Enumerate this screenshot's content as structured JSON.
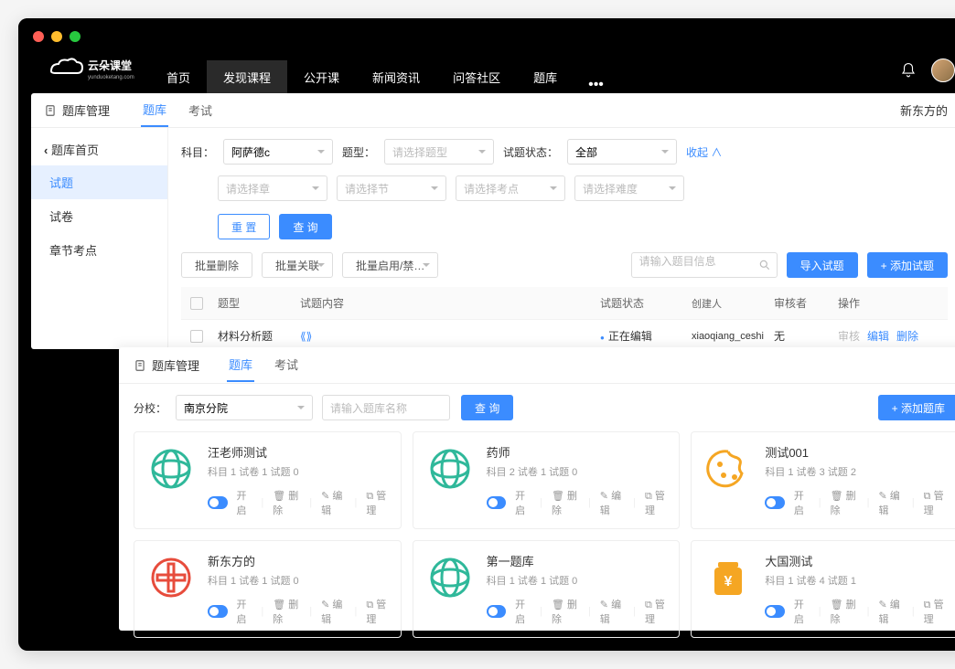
{
  "brand": {
    "name": "云朵课堂",
    "sub": "yunduoketang.com"
  },
  "nav": [
    {
      "label": "首页",
      "active": false
    },
    {
      "label": "发现课程",
      "active": true
    },
    {
      "label": "公开课",
      "active": false
    },
    {
      "label": "新闻资讯",
      "active": false
    },
    {
      "label": "问答社区",
      "active": false
    },
    {
      "label": "题库",
      "active": false
    }
  ],
  "panel1": {
    "breadcrumb_title": "题库管理",
    "right_tag": "新东方的",
    "back_label": "题库首页",
    "sidebar": [
      {
        "label": "试题",
        "active": true
      },
      {
        "label": "试卷",
        "active": false
      },
      {
        "label": "章节考点",
        "active": false
      }
    ],
    "tabs": [
      {
        "label": "题库",
        "active": true
      },
      {
        "label": "考试",
        "active": false
      }
    ],
    "filters": {
      "subject_label": "科目：",
      "subject_value": "阿萨德c",
      "type_label": "题型：",
      "type_ph": "请选择题型",
      "status_label": "试题状态：",
      "status_value": "全部",
      "collapse": "收起",
      "chapter_ph": "请选择章",
      "section_ph": "请选择节",
      "point_ph": "请选择考点",
      "difficulty_ph": "请选择难度"
    },
    "buttons": {
      "reset": "重 置",
      "query": "查 询",
      "batch_delete": "批量删除",
      "batch_relate": "批量关联",
      "batch_toggle": "批量启用/禁…",
      "search_ph": "请输入题目信息",
      "import": "导入试题",
      "add": "+ 添加试题"
    },
    "table": {
      "headers": {
        "type": "题型",
        "content": "试题内容",
        "status": "试题状态",
        "creator": "创建人",
        "reviewer": "审核者",
        "ops": "操作"
      },
      "rows": [
        {
          "type": "材料分析题",
          "content_icon": "audio",
          "status": "正在编辑",
          "creator": "xiaoqiang_ceshi",
          "reviewer": "无",
          "ops": {
            "review": "审核",
            "edit": "编辑",
            "delete": "删除"
          }
        }
      ]
    }
  },
  "panel2": {
    "title": "题库管理",
    "tabs": [
      {
        "label": "题库",
        "active": true
      },
      {
        "label": "考试",
        "active": false
      }
    ],
    "filter": {
      "branch_label": "分校：",
      "branch_value": "南京分院",
      "name_ph": "请输入题库名称",
      "query": "查 询",
      "add": "+ 添加题库"
    },
    "card_ops": {
      "open": "开启",
      "delete": "删除",
      "edit": "编辑",
      "manage": "管理"
    },
    "cards": [
      {
        "title": "汪老师测试",
        "meta": "科目 1  试卷 1  试题 0",
        "icon": "globe-teal"
      },
      {
        "title": "药师",
        "meta": "科目 2  试卷 1  试题 0",
        "icon": "globe-teal"
      },
      {
        "title": "测试001",
        "meta": "科目 1  试卷 3  试题 2",
        "icon": "palette-orange"
      },
      {
        "title": "新东方的",
        "meta": "科目 1  试卷 1  试题 0",
        "icon": "coin-red"
      },
      {
        "title": "第一题库",
        "meta": "科目 1  试卷 1  试题 0",
        "icon": "globe-teal"
      },
      {
        "title": "大国测试",
        "meta": "科目 1  试卷 4  试题 1",
        "icon": "jar-orange"
      }
    ]
  }
}
